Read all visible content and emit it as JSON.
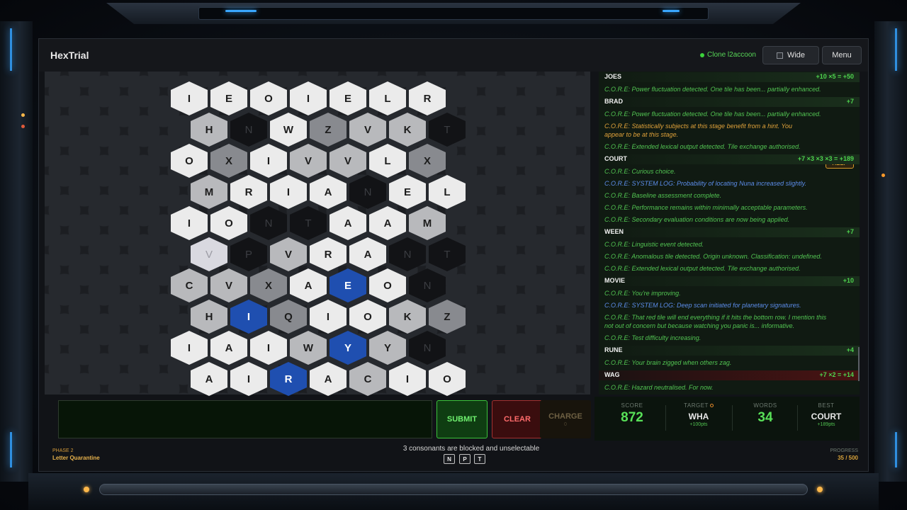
{
  "app": {
    "title": "HexTrial"
  },
  "header": {
    "status": "Clone l2accoon",
    "wide_label": "Wide",
    "menu_label": "Menu"
  },
  "board": {
    "rows": [
      {
        "tiles": [
          {
            "l": "I",
            "s": "white"
          },
          {
            "l": "E",
            "s": "white"
          },
          {
            "l": "O",
            "s": "white"
          },
          {
            "l": "I",
            "s": "white"
          },
          {
            "l": "E",
            "s": "white"
          },
          {
            "l": "L",
            "s": "white"
          },
          {
            "l": "R",
            "s": "white"
          }
        ]
      },
      {
        "tiles": [
          {
            "l": "H",
            "s": "light"
          },
          {
            "l": "N",
            "s": "dark"
          },
          {
            "l": "W",
            "s": "white"
          },
          {
            "l": "Z",
            "s": "gray"
          },
          {
            "l": "V",
            "s": "light"
          },
          {
            "l": "K",
            "s": "light"
          },
          {
            "l": "T",
            "s": "dark"
          }
        ]
      },
      {
        "tiles": [
          {
            "l": "O",
            "s": "white"
          },
          {
            "l": "X",
            "s": "gray"
          },
          {
            "l": "I",
            "s": "white"
          },
          {
            "l": "V",
            "s": "light"
          },
          {
            "l": "V",
            "s": "light"
          },
          {
            "l": "L",
            "s": "white"
          },
          {
            "l": "X",
            "s": "gray"
          }
        ]
      },
      {
        "tiles": [
          {
            "l": "M",
            "s": "light"
          },
          {
            "l": "R",
            "s": "white"
          },
          {
            "l": "I",
            "s": "white"
          },
          {
            "l": "A",
            "s": "white"
          },
          {
            "l": "N",
            "s": "dark"
          },
          {
            "l": "E",
            "s": "white"
          },
          {
            "l": "L",
            "s": "white"
          }
        ]
      },
      {
        "tiles": [
          {
            "l": "I",
            "s": "white"
          },
          {
            "l": "O",
            "s": "white"
          },
          {
            "l": "N",
            "s": "dark"
          },
          {
            "l": "T",
            "s": "dark"
          },
          {
            "l": "A",
            "s": "white"
          },
          {
            "l": "A",
            "s": "white"
          },
          {
            "l": "M",
            "s": "light"
          }
        ]
      },
      {
        "tiles": [
          {
            "l": "V",
            "s": "pale"
          },
          {
            "l": "P",
            "s": "dark"
          },
          {
            "l": "V",
            "s": "light"
          },
          {
            "l": "R",
            "s": "white"
          },
          {
            "l": "A",
            "s": "white"
          },
          {
            "l": "N",
            "s": "dark"
          },
          {
            "l": "T",
            "s": "dark"
          }
        ]
      },
      {
        "tiles": [
          {
            "l": "C",
            "s": "light"
          },
          {
            "l": "V",
            "s": "light"
          },
          {
            "l": "X",
            "s": "gray"
          },
          {
            "l": "A",
            "s": "white"
          },
          {
            "l": "E",
            "s": "blue"
          },
          {
            "l": "O",
            "s": "white"
          },
          {
            "l": "N",
            "s": "dark"
          }
        ]
      },
      {
        "tiles": [
          {
            "l": "H",
            "s": "light"
          },
          {
            "l": "I",
            "s": "blue"
          },
          {
            "l": "Q",
            "s": "gray"
          },
          {
            "l": "I",
            "s": "white"
          },
          {
            "l": "O",
            "s": "white"
          },
          {
            "l": "K",
            "s": "light"
          },
          {
            "l": "Z",
            "s": "gray"
          }
        ]
      },
      {
        "tiles": [
          {
            "l": "I",
            "s": "white"
          },
          {
            "l": "A",
            "s": "white"
          },
          {
            "l": "I",
            "s": "white"
          },
          {
            "l": "W",
            "s": "light"
          },
          {
            "l": "Y",
            "s": "blue"
          },
          {
            "l": "Y",
            "s": "light"
          },
          {
            "l": "N",
            "s": "dark"
          }
        ]
      },
      {
        "tiles": [
          {
            "l": "A",
            "s": "white"
          },
          {
            "l": "I",
            "s": "white"
          },
          {
            "l": "R",
            "s": "blue"
          },
          {
            "l": "A",
            "s": "white"
          },
          {
            "l": "C",
            "s": "light"
          },
          {
            "l": "I",
            "s": "white"
          },
          {
            "l": "O",
            "s": "white"
          }
        ]
      }
    ]
  },
  "log": {
    "entries": [
      {
        "type": "word",
        "word": "JOES",
        "points": "+10 ×5 = +50"
      },
      {
        "type": "msg",
        "text": "C.O.R.E: Power fluctuation detected. One tile has been... partially enhanced."
      },
      {
        "type": "word",
        "word": "BRAD",
        "points": "+7"
      },
      {
        "type": "msg",
        "text": "C.O.R.E: Power fluctuation detected. One tile has been... partially enhanced."
      },
      {
        "type": "hint",
        "text": "C.O.R.E: Statistically subjects at this stage benefit from a hint. You",
        "text2": "appear to be at this stage."
      },
      {
        "type": "msg",
        "text": "C.O.R.E: Extended lexical output detected. Tile exchange authorised."
      },
      {
        "type": "word",
        "word": "COURT",
        "points": "+7 ×3 ×3 ×3 = +189"
      },
      {
        "type": "msg",
        "text": "C.O.R.E: Curious choice."
      },
      {
        "type": "sys",
        "text": "C.O.R.E: SYSTEM LOG: Probability of locating Nuna increased slightly."
      },
      {
        "type": "msg",
        "text": "C.O.R.E: Baseline assessment complete."
      },
      {
        "type": "msg",
        "text": "C.O.R.E: Performance remains within minimally acceptable parameters."
      },
      {
        "type": "msg",
        "text": "C.O.R.E: Secondary evaluation conditions are now being applied."
      },
      {
        "type": "word",
        "word": "WEEN",
        "points": "+7"
      },
      {
        "type": "msg",
        "text": "C.O.R.E: Linguistic event detected."
      },
      {
        "type": "msg",
        "text": "C.O.R.E: Anomalous tile detected. Origin unknown. Classification: undefined."
      },
      {
        "type": "msg",
        "text": "C.O.R.E: Extended lexical output detected. Tile exchange authorised."
      },
      {
        "type": "word",
        "word": "MOVIE",
        "points": "+10"
      },
      {
        "type": "msg",
        "text": "C.O.R.E: You're improving."
      },
      {
        "type": "sys",
        "text": "C.O.R.E: SYSTEM LOG: Deep scan initiated for planetary signatures."
      },
      {
        "type": "msg2",
        "text": "C.O.R.E: That red tile will end everything if it hits the bottom row. I mention this",
        "text2": "not out of concern but because watching you panic is... informative."
      },
      {
        "type": "msg",
        "text": "C.O.R.E: Test difficulty increasing."
      },
      {
        "type": "word",
        "word": "RUNE",
        "points": "+4"
      },
      {
        "type": "msg",
        "text": "C.O.R.E: Your brain zigged when others zag."
      },
      {
        "type": "word-red",
        "word": "WAG",
        "points": "+7 ×2 = +14"
      },
      {
        "type": "msg",
        "text": "C.O.R.E: Hazard neutralised. For now."
      }
    ],
    "help_label": "HELP"
  },
  "controls": {
    "submit": "SUBMIT",
    "clear": "CLEAR",
    "charge": "CHARGE",
    "charge_count": "0"
  },
  "stats": {
    "score_label": "SCORE",
    "score": "872",
    "target_label": "TARGET",
    "target": "WHA",
    "target_sub": "+100pts",
    "words_label": "WORDS",
    "words": "34",
    "best_label": "BEST",
    "best": "COURT",
    "best_sub": "+189pts"
  },
  "footer": {
    "phase_label": "PHASE 2",
    "phase_name": "Letter Quarantine",
    "blocked_text": "3 consonants are blocked and unselectable",
    "blocked_keys": [
      "N",
      "P",
      "T"
    ],
    "progress_label": "PROGRESS",
    "progress": "35 / 500"
  },
  "colors": {
    "accent": "#3aa7ff",
    "log_green": "#52c452",
    "tile_blue": "#1f4fb0",
    "warning": "#e0a23a"
  }
}
